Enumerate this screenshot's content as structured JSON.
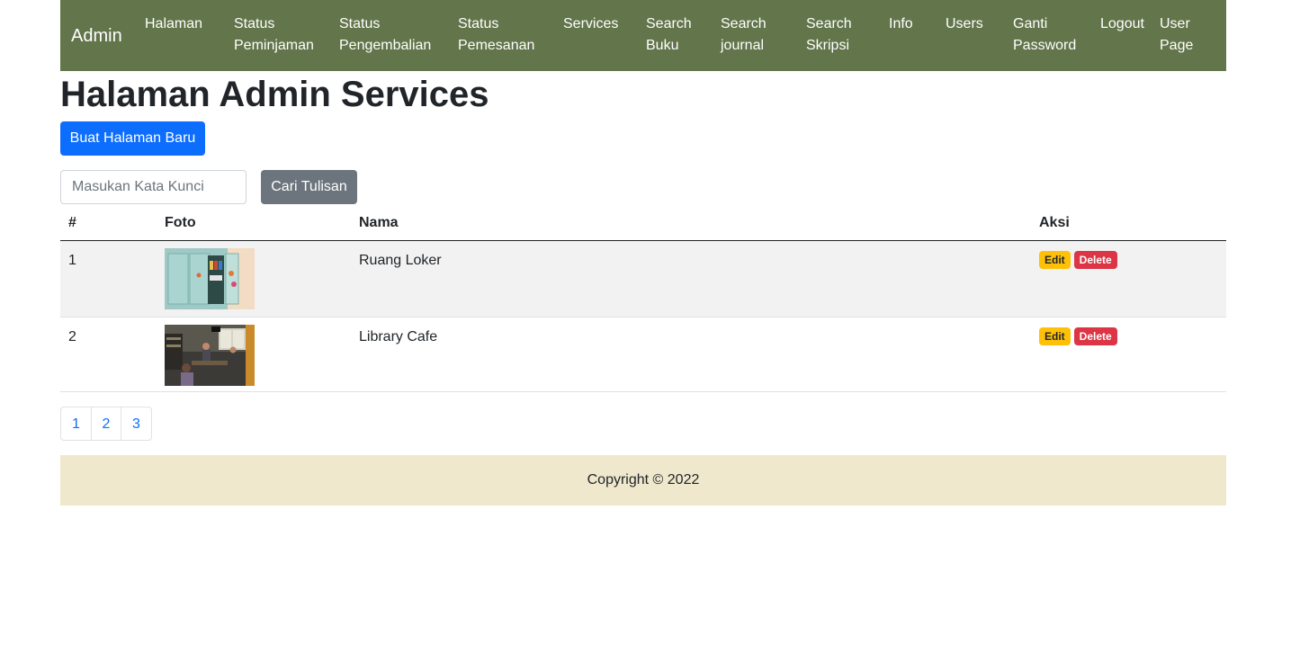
{
  "navbar": {
    "brand": "Admin",
    "items": [
      {
        "label_l1": "Halaman",
        "label_l2": ""
      },
      {
        "label_l1": "Status",
        "label_l2": "Peminjaman"
      },
      {
        "label_l1": "Status",
        "label_l2": "Pengembalian"
      },
      {
        "label_l1": "Status",
        "label_l2": "Pemesanan"
      },
      {
        "label_l1": "Services",
        "label_l2": ""
      },
      {
        "label_l1": "Search",
        "label_l2": "Buku"
      },
      {
        "label_l1": "Search",
        "label_l2": "journal"
      },
      {
        "label_l1": "Search",
        "label_l2": "Skripsi"
      },
      {
        "label_l1": "Info",
        "label_l2": ""
      },
      {
        "label_l1": "Users",
        "label_l2": ""
      },
      {
        "label_l1": "Ganti",
        "label_l2": "Password"
      },
      {
        "label_l1": "Logout",
        "label_l2": ""
      },
      {
        "label_l1": "User",
        "label_l2": "Page"
      }
    ]
  },
  "page": {
    "title": "Halaman Admin Services",
    "new_button": "Buat Halaman Baru",
    "search_placeholder": "Masukan Kata Kunci",
    "search_button": "Cari Tulisan"
  },
  "table": {
    "headers": {
      "num": "#",
      "photo": "Foto",
      "name": "Nama",
      "actions": "Aksi"
    },
    "rows": [
      {
        "num": "1",
        "name": "Ruang Loker",
        "edit": "Edit",
        "delete": "Delete"
      },
      {
        "num": "2",
        "name": "Library Cafe",
        "edit": "Edit",
        "delete": "Delete"
      }
    ]
  },
  "pagination": [
    "1",
    "2",
    "3"
  ],
  "footer": {
    "text": "Copyright © 2022"
  },
  "colors": {
    "navbar": "#63754a",
    "primary": "#0d6efd",
    "secondary": "#6c757d",
    "warning": "#ffc107",
    "danger": "#dc3545",
    "footer": "#efe8cc"
  }
}
